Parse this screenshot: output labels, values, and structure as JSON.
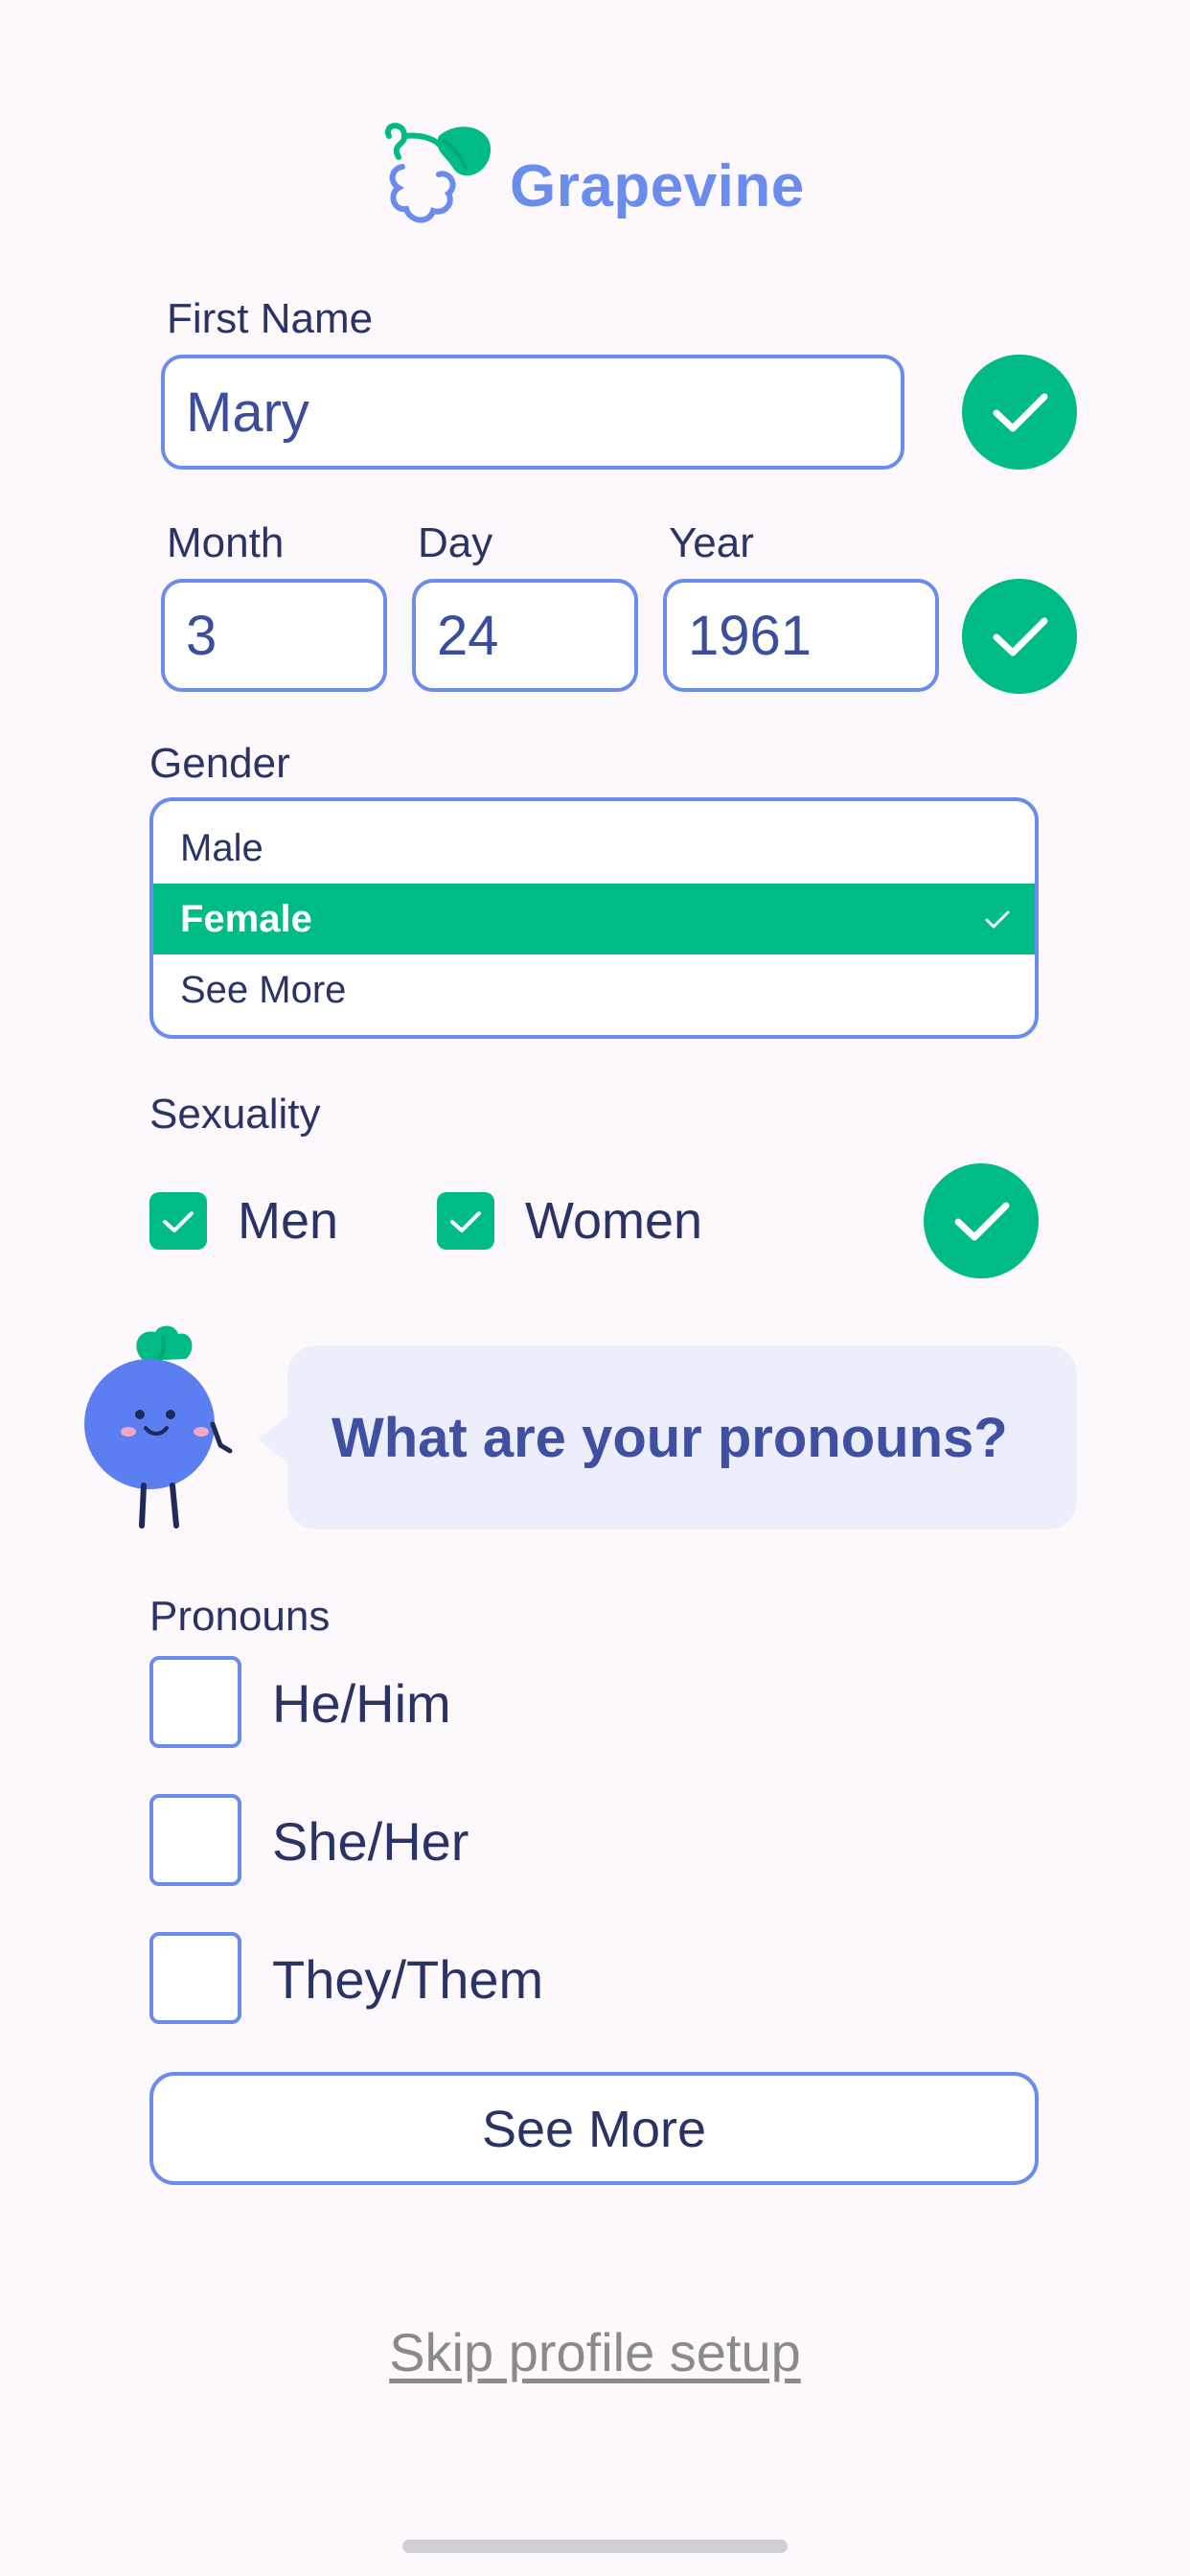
{
  "app": {
    "name": "Grapevine"
  },
  "colors": {
    "accent_blue": "#6a8ded",
    "accent_green": "#00bb85",
    "text_dark": "#2a3366",
    "background": "#fdf8fb"
  },
  "first_name": {
    "label": "First Name",
    "value": "Mary"
  },
  "birthdate": {
    "month": {
      "label": "Month",
      "value": "3"
    },
    "day": {
      "label": "Day",
      "value": "24"
    },
    "year": {
      "label": "Year",
      "value": "1961"
    }
  },
  "gender": {
    "label": "Gender",
    "options": [
      {
        "label": "Male",
        "selected": false
      },
      {
        "label": "Female",
        "selected": true
      },
      {
        "label": "See More",
        "selected": false
      }
    ]
  },
  "sexuality": {
    "label": "Sexuality",
    "options": [
      {
        "label": "Men",
        "checked": true
      },
      {
        "label": "Women",
        "checked": true
      }
    ]
  },
  "prompt": {
    "text": "What are your pronouns?"
  },
  "pronouns": {
    "label": "Pronouns",
    "options": [
      {
        "label": "He/Him",
        "checked": false
      },
      {
        "label": "She/Her",
        "checked": false
      },
      {
        "label": "They/Them",
        "checked": false
      }
    ],
    "see_more": "See More"
  },
  "skip": {
    "label": "Skip profile setup"
  },
  "icons": {
    "logo": "grape-logo-icon",
    "field_valid": "check-circle-icon",
    "checkbox_checked": "checkmark-icon",
    "mascot": "grape-mascot-icon"
  }
}
